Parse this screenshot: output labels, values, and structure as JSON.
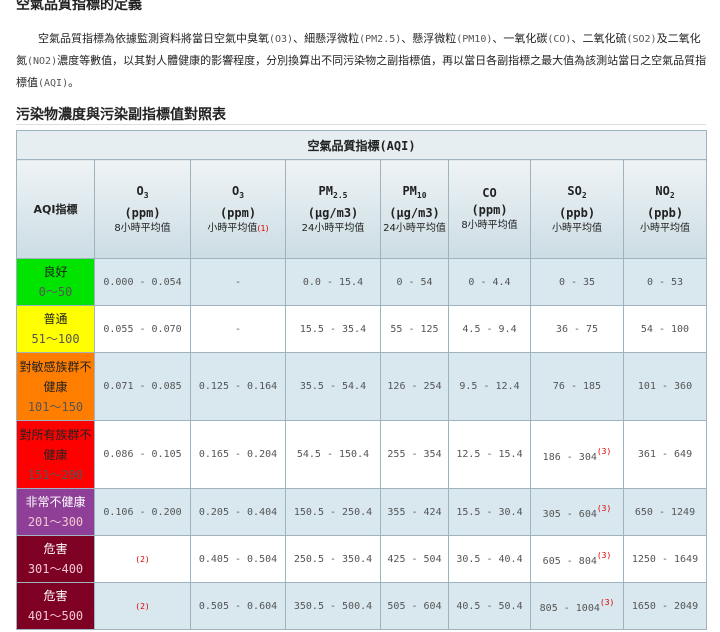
{
  "heading": "空氣品質指標的定義",
  "paragraph": {
    "intro": "空氣品質指標為依據監測資料將當日空氣中臭氧",
    "o3": "(O3)",
    "sep1": "、細懸浮微粒",
    "pm25": "(PM2.5)",
    "sep2": "、懸浮微粒",
    "pm10": "(PM10)",
    "sep3": "、一氧化碳",
    "co": "(CO)",
    "sep4": "、二氧化硫",
    "so2": "(SO2)",
    "sep5": "及二氧化氮",
    "no2": "(NO2)",
    "body": "濃度等數值，以其對人體健康的影響程度，分別換算出不同污染物之副指標值，再以當日各副指標之最大值為該測站當日之空氣品質指標值",
    "aqi": "(AQI)",
    "end": "。"
  },
  "table_heading": "污染物濃度與污染副指標值對照表",
  "table": {
    "title": "空氣品質指標(AQI)",
    "aqi_col": "AQI指標",
    "columns": [
      {
        "name": "O",
        "sub": "3",
        "unit": "(ppm)",
        "avg": "8小時平均值",
        "note": ""
      },
      {
        "name": "O",
        "sub": "3",
        "unit": "(ppm)",
        "avg": "小時平均值",
        "note": "(1)"
      },
      {
        "name": "PM",
        "sub": "2.5",
        "unit": "(μg/m3)",
        "avg": "24小時平均值",
        "note": ""
      },
      {
        "name": "PM",
        "sub": "10",
        "unit": "(μg/m3)",
        "avg": "24小時平均值",
        "note": ""
      },
      {
        "name": "CO",
        "sub": "",
        "unit": "(ppm)",
        "avg": "8小時平均值",
        "note": ""
      },
      {
        "name": "SO",
        "sub": "2",
        "unit": "(ppb)",
        "avg": "小時平均值",
        "note": ""
      },
      {
        "name": "NO",
        "sub": "2",
        "unit": "(ppb)",
        "avg": "小時平均值",
        "note": ""
      }
    ],
    "rows": [
      {
        "label": "良好",
        "range": "0～50",
        "bg": "#00e400",
        "fg": "#222222",
        "o3_8h": "0.000 - 0.054",
        "o3_1h": "-",
        "pm25": "0.0 - 15.4",
        "pm10": "0 - 54",
        "co": "0 - 4.4",
        "so2": "0 - 35",
        "so2_note": "",
        "no2": "0 - 53"
      },
      {
        "label": "普通",
        "range": "51～100",
        "bg": "#ffff00",
        "fg": "#222222",
        "o3_8h": "0.055 - 0.070",
        "o3_1h": "-",
        "pm25": "15.5 - 35.4",
        "pm10": "55 - 125",
        "co": "4.5 - 9.4",
        "so2": "36 - 75",
        "so2_note": "",
        "no2": "54 - 100"
      },
      {
        "label": "對敏感族群不健康",
        "range": "101～150",
        "bg": "#ff7e00",
        "fg": "#222222",
        "o3_8h": "0.071 - 0.085",
        "o3_1h": "0.125 - 0.164",
        "pm25": "35.5 - 54.4",
        "pm10": "126 - 254",
        "co": "9.5 - 12.4",
        "so2": "76 - 185",
        "so2_note": "",
        "no2": "101 - 360"
      },
      {
        "label": "對所有族群不健康",
        "range": "151～200",
        "bg": "#ff0000",
        "fg": "#222222",
        "o3_8h": "0.086 - 0.105",
        "o3_1h": "0.165 - 0.204",
        "pm25": "54.5 - 150.4",
        "pm10": "255 - 354",
        "co": "12.5 - 15.4",
        "so2": "186 - 304",
        "so2_note": "(3)",
        "no2": "361 - 649"
      },
      {
        "label": "非常不健康",
        "range": "201～300",
        "bg": "#8f3f97",
        "fg": "#ffffff",
        "o3_8h": "0.106 - 0.200",
        "o3_1h": "0.205 - 0.404",
        "pm25": "150.5 - 250.4",
        "pm10": "355 - 424",
        "co": "15.5 - 30.4",
        "so2": "305 - 604",
        "so2_note": "(3)",
        "no2": "650 - 1249"
      },
      {
        "label": "危害",
        "range": "301～400",
        "bg": "#7e0023",
        "fg": "#ffffff",
        "o3_8h": "(2)",
        "o3_1h": "0.405 - 0.504",
        "pm25": "250.5 - 350.4",
        "pm10": "425 - 504",
        "co": "30.5 - 40.4",
        "so2": "605 - 804",
        "so2_note": "(3)",
        "no2": "1250 - 1649"
      },
      {
        "label": "危害",
        "range": "401～500",
        "bg": "#7e0023",
        "fg": "#ffffff",
        "o3_8h": "(2)",
        "o3_1h": "0.505 - 0.604",
        "pm25": "350.5 - 500.4",
        "pm10": "505 - 604",
        "co": "40.5 - 50.4",
        "so2": "805 - 1004",
        "so2_note": "(3)",
        "no2": "1650 - 2049"
      }
    ]
  }
}
